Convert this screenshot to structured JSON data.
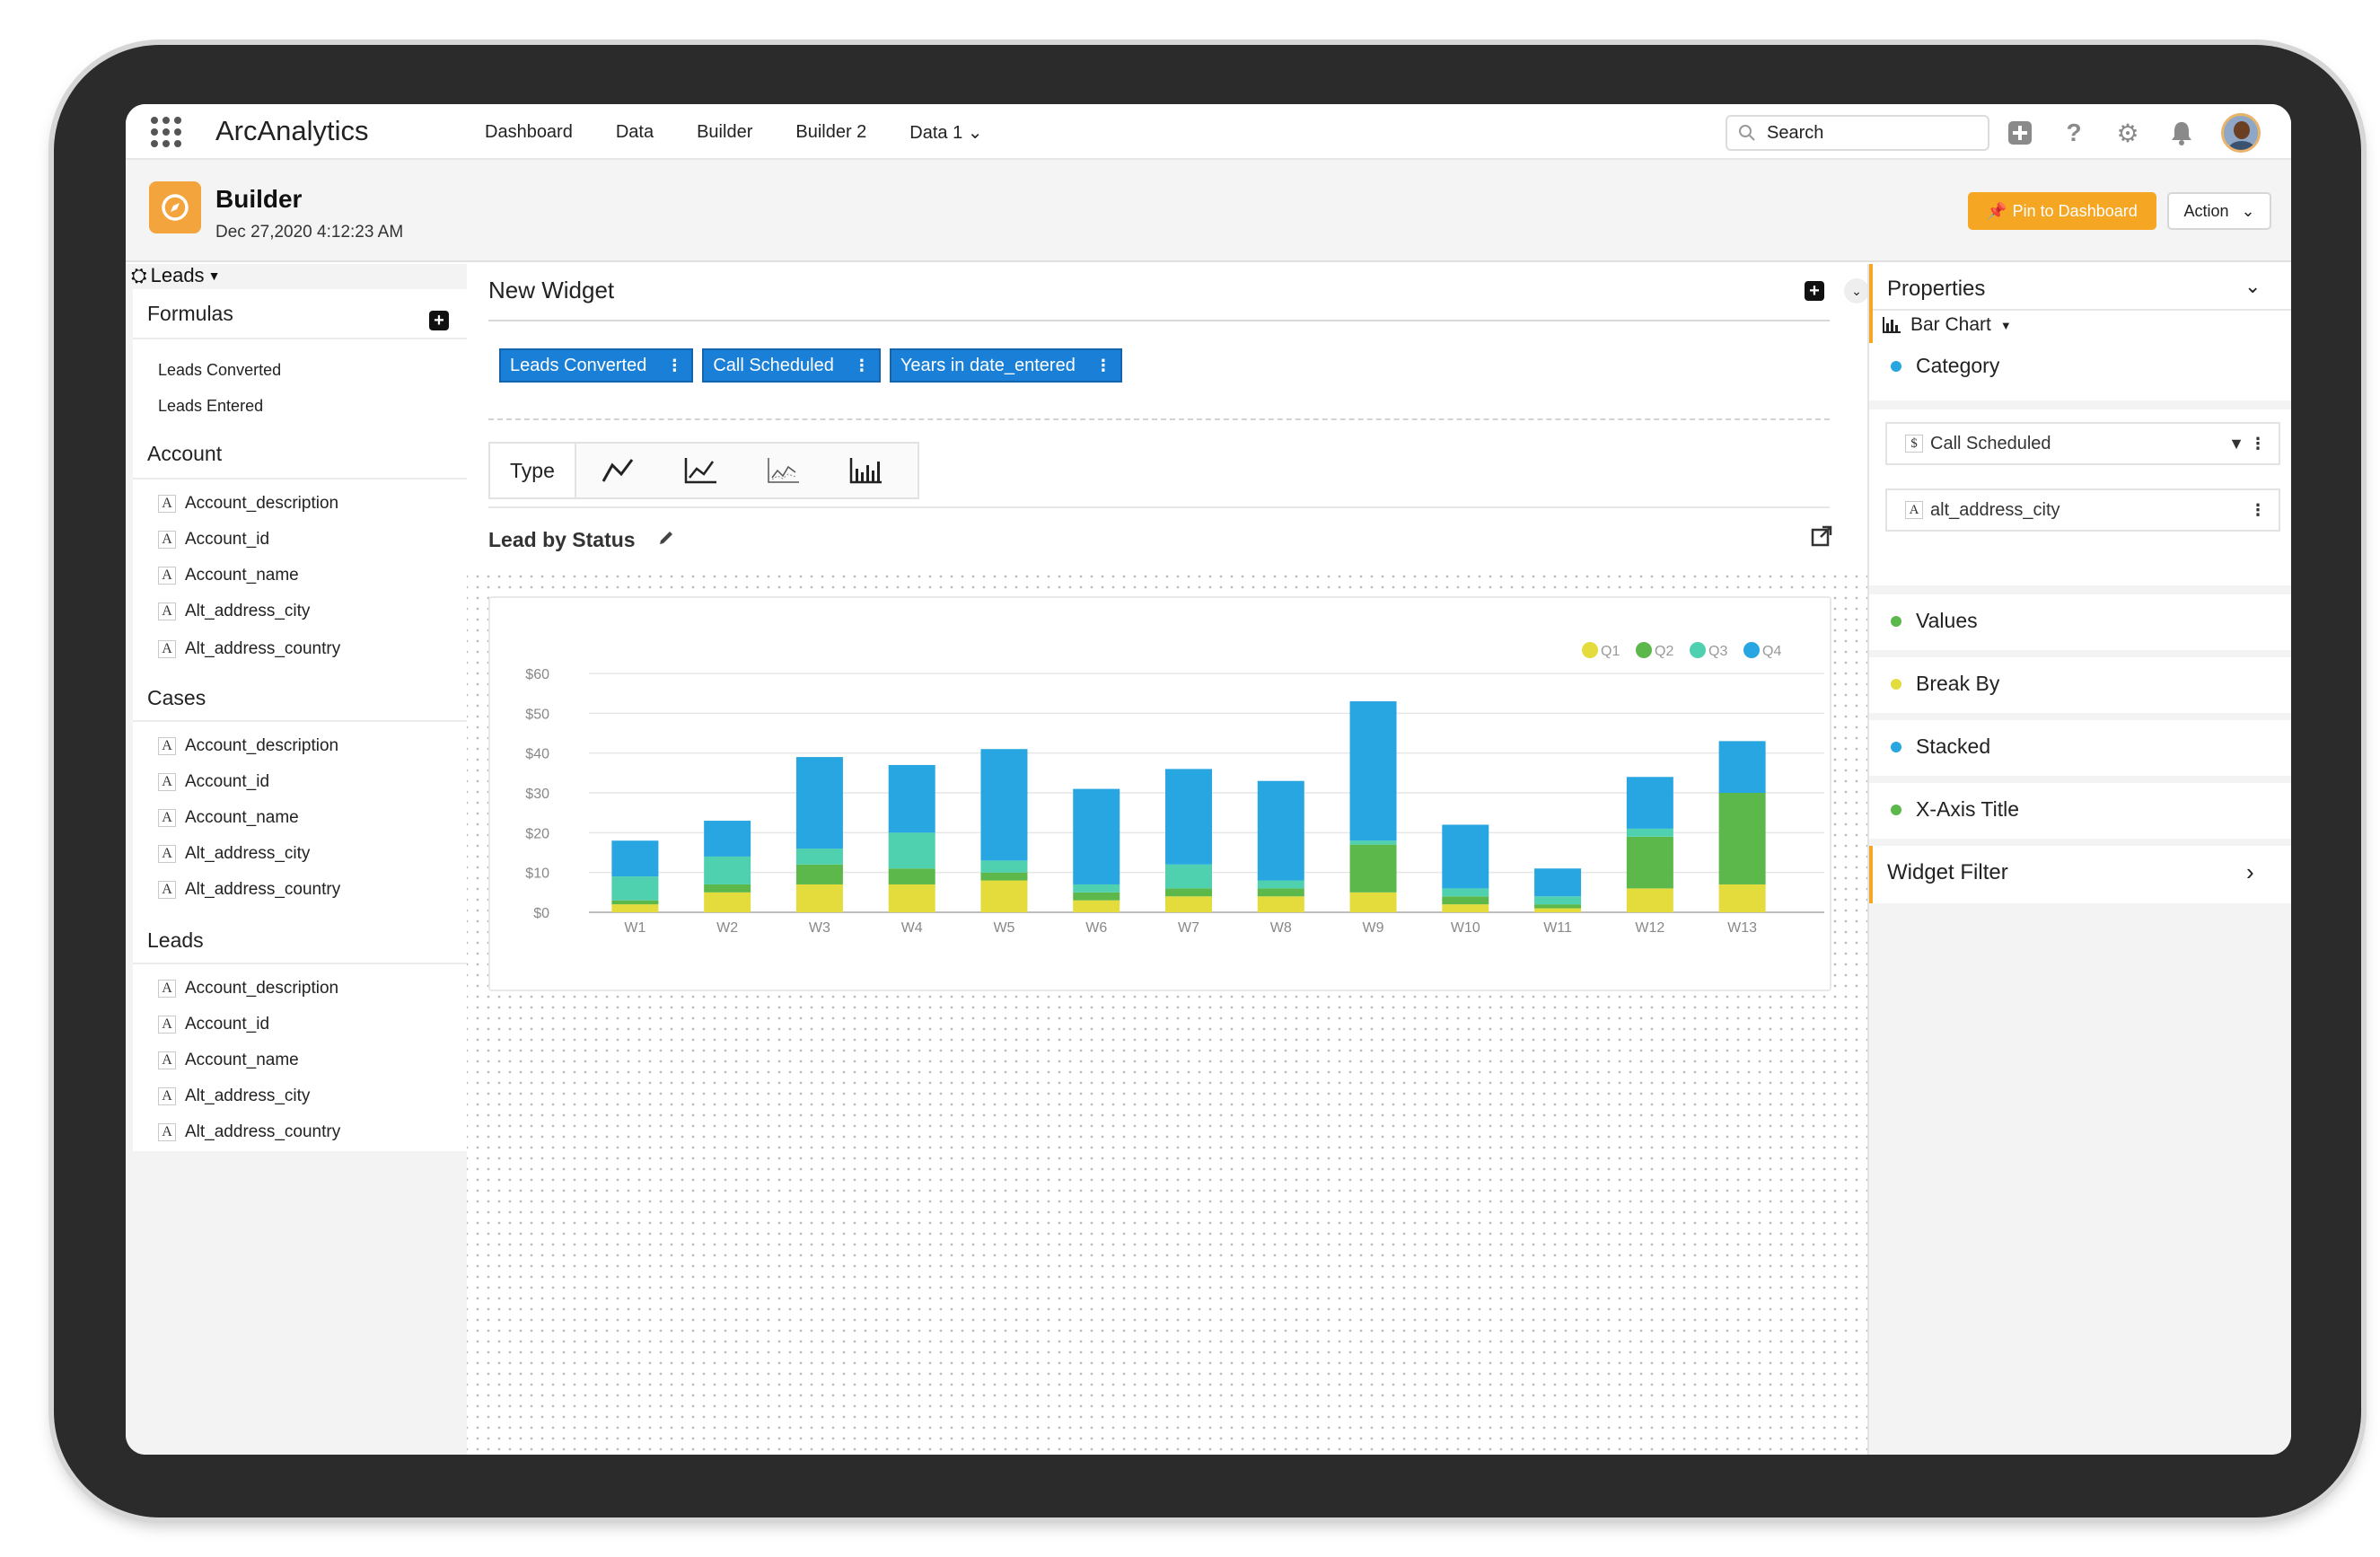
{
  "app": {
    "name": "ArcAnalytics"
  },
  "nav": [
    "Dashboard",
    "Data",
    "Builder",
    "Builder 2",
    "Data 1 ⌄"
  ],
  "search": {
    "placeholder": "Search"
  },
  "header": {
    "title": "Builder",
    "date": "Dec 27,2020 4:12:23 AM",
    "pin_label": "Pin to Dashboard",
    "action_label": "Action"
  },
  "left": {
    "dataset": "Leads",
    "formulas_title": "Formulas",
    "formulas": [
      "Leads Converted",
      "Leads Entered"
    ],
    "groups": [
      {
        "title": "Account",
        "fields": [
          "Account_description",
          "Account_id",
          "Account_name",
          "Alt_address_city",
          "Alt_address_country"
        ]
      },
      {
        "title": "Cases",
        "fields": [
          "Account_description",
          "Account_id",
          "Account_name",
          "Alt_address_city",
          "Alt_address_country"
        ]
      },
      {
        "title": "Leads",
        "fields": [
          "Account_description",
          "Account_id",
          "Account_name",
          "Alt_address_city",
          "Alt_address_country"
        ]
      }
    ]
  },
  "widget": {
    "title": "New Widget",
    "chips": [
      "Leads Converted",
      "Call Scheduled",
      "Years in date_entered"
    ],
    "type_label": "Type",
    "chart_title": "Lead by Status"
  },
  "chart_data": {
    "type": "bar",
    "stacked": true,
    "title": "",
    "xlabel": "",
    "ylabel": "",
    "categories": [
      "W1",
      "W2",
      "W3",
      "W4",
      "W5",
      "W6",
      "W7",
      "W8",
      "W9",
      "W10",
      "W11",
      "W12",
      "W13"
    ],
    "ylim": [
      0,
      60
    ],
    "yticks": [
      "$0",
      "$10",
      "$20",
      "$30",
      "$40",
      "$50",
      "$60"
    ],
    "legend_position": "top-right",
    "series": [
      {
        "name": "Q1",
        "color": "#e3dc3c",
        "values": [
          2,
          5,
          7,
          7,
          8,
          3,
          4,
          4,
          5,
          2,
          1,
          6,
          7
        ]
      },
      {
        "name": "Q2",
        "color": "#5cb84a",
        "values": [
          1,
          2,
          5,
          4,
          2,
          2,
          2,
          2,
          12,
          2,
          1,
          13,
          23
        ]
      },
      {
        "name": "Q3",
        "color": "#4fd1b0",
        "values": [
          6,
          7,
          4,
          9,
          3,
          2,
          6,
          2,
          1,
          2,
          2,
          2,
          0
        ]
      },
      {
        "name": "Q4",
        "color": "#27a6e1",
        "values": [
          9,
          9,
          23,
          17,
          28,
          24,
          24,
          25,
          35,
          16,
          7,
          13,
          13
        ]
      }
    ]
  },
  "properties": {
    "title": "Properties",
    "chart_type": "Bar Chart",
    "category_label": "Category",
    "category_fields": [
      "Call Scheduled",
      "alt_address_city"
    ],
    "items": [
      {
        "label": "Values",
        "color": "#5cb84a"
      },
      {
        "label": "Break By",
        "color": "#e3dc3c"
      },
      {
        "label": "Stacked",
        "color": "#27a6e1"
      },
      {
        "label": "X-Axis Title",
        "color": "#5cb84a"
      }
    ],
    "category_color": "#27a6e1",
    "widget_filter": "Widget Filter"
  }
}
